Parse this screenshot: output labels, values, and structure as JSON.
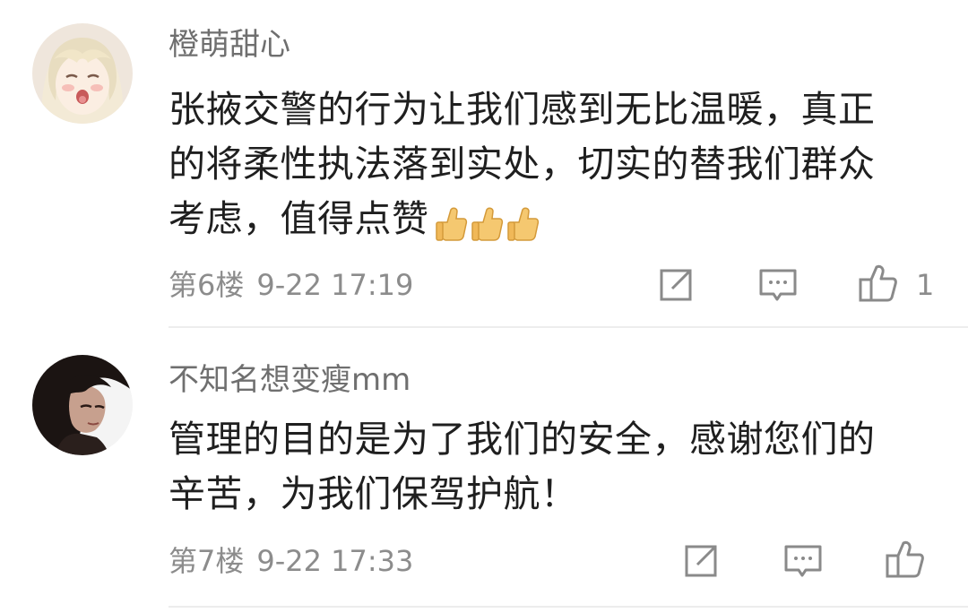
{
  "comments": [
    {
      "username": "橙萌甜心",
      "avatar_icon": "anime-girl-avatar",
      "content_lines": [
        "张掖交警的行为让我们感到无比温暖，真正",
        "的将柔性执法落到实处，切实的替我们群众",
        "考虑，值得点赞"
      ],
      "emoji": [
        "thumbs-up-emoji",
        "thumbs-up-emoji",
        "thumbs-up-emoji"
      ],
      "floor": "第6楼",
      "time": "9-22 17:19",
      "actions": {
        "share_icon": "share-icon",
        "reply_icon": "reply-icon",
        "like_icon": "thumbs-up-icon",
        "like_count": "1"
      }
    },
    {
      "username": "不知名想变瘦mm",
      "avatar_icon": "woman-portrait-avatar",
      "content_lines": [
        "管理的目的是为了我们的安全，感谢您们的",
        "辛苦，为我们保驾护航！"
      ],
      "floor": "第7楼",
      "time": "9-22 17:33",
      "actions": {
        "share_icon": "share-icon",
        "reply_icon": "reply-icon",
        "like_icon": "thumbs-up-icon"
      }
    }
  ],
  "colors": {
    "username": "#6f6f6f",
    "content": "#1f1f1f",
    "meta": "#8c8c8c",
    "icon": "#8a8a8a",
    "divider": "#ededed"
  }
}
